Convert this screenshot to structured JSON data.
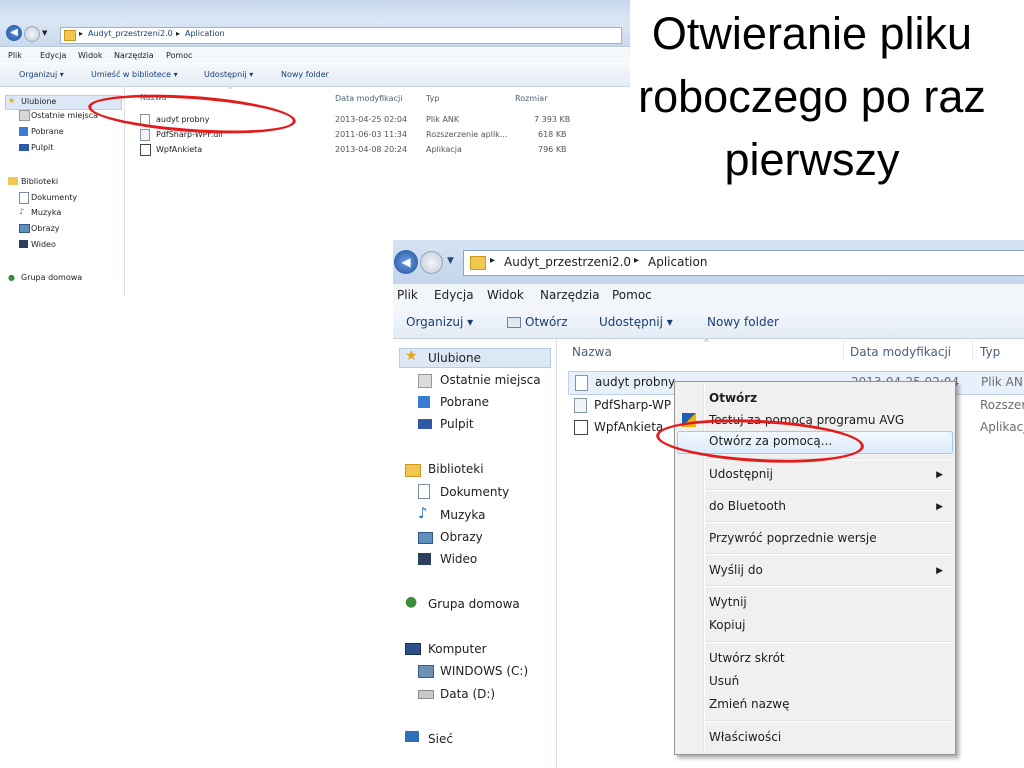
{
  "slide": {
    "title": "Otwieranie pliku roboczego po raz pierwszy"
  },
  "small": {
    "breadcrumb": [
      "Audyt_przestrzeni2.0",
      "Aplication"
    ],
    "menu": [
      "Plik",
      "Edycja",
      "Widok",
      "Narzędzia",
      "Pomoc"
    ],
    "toolbar": [
      "Organizuj ▾",
      "Umieść w bibliotece ▾",
      "Udostępnij ▾",
      "Nowy folder"
    ],
    "nav": {
      "favorites": "Ulubione",
      "favorites_items": [
        "Ostatnie miejsca",
        "Pobrane",
        "Pulpit"
      ],
      "libraries": "Biblioteki",
      "libraries_items": [
        "Dokumenty",
        "Muzyka",
        "Obrazy",
        "Wideo"
      ],
      "homegroup": "Grupa domowa"
    },
    "columns": {
      "name": "Nazwa",
      "date": "Data modyfikacji",
      "type": "Typ",
      "size": "Rozmiar"
    },
    "files": [
      {
        "name": "audyt probny",
        "date": "2013-04-25 02:04",
        "type": "Plik ANK",
        "size": "7 393 KB"
      },
      {
        "name": "PdfSharp-WPF.dll",
        "date": "2011-06-03 11:34",
        "type": "Rozszerzenie aplik...",
        "size": "618 KB"
      },
      {
        "name": "WpfAnkieta",
        "date": "2013-04-08 20:24",
        "type": "Aplikacja",
        "size": "796 KB"
      }
    ]
  },
  "large": {
    "breadcrumb": [
      "Audyt_przestrzeni2.0",
      "Aplication"
    ],
    "menu": [
      "Plik",
      "Edycja",
      "Widok",
      "Narzędzia",
      "Pomoc"
    ],
    "toolbar": {
      "organize": "Organizuj ▾",
      "open": "Otwórz",
      "share": "Udostępnij ▾",
      "new_folder": "Nowy folder"
    },
    "nav": {
      "favorites": "Ulubione",
      "favorites_items": [
        "Ostatnie miejsca",
        "Pobrane",
        "Pulpit"
      ],
      "libraries": "Biblioteki",
      "libraries_items": [
        "Dokumenty",
        "Muzyka",
        "Obrazy",
        "Wideo"
      ],
      "homegroup": "Grupa domowa",
      "computer": "Komputer",
      "computer_items": [
        "WINDOWS (C:)",
        "Data (D:)"
      ],
      "network": "Sieć"
    },
    "columns": {
      "name": "Nazwa",
      "date": "Data modyfikacji",
      "type": "Typ"
    },
    "files": [
      {
        "name": "audyt probny",
        "date": "2013-04-25 02:04",
        "type": "Plik ANK"
      },
      {
        "name": "PdfSharp-WP",
        "type": "Rozszerz"
      },
      {
        "name": "WpfAnkieta",
        "type": "Aplikacj"
      }
    ]
  },
  "context_menu": {
    "open": "Otwórz",
    "scan_avg": "Testuj za pomocą programu AVG",
    "open_with": "Otwórz za pomocą...",
    "share": "Udostępnij",
    "bluetooth": "do Bluetooth",
    "restore": "Przywróć poprzednie wersje",
    "send_to": "Wyślij do",
    "cut": "Wytnij",
    "copy": "Kopiuj",
    "shortcut": "Utwórz skrót",
    "delete": "Usuń",
    "rename": "Zmień nazwę",
    "properties": "Właściwości",
    "submenu_arrow": "▶"
  },
  "colors": {
    "annotation_red": "#e41b1b",
    "window_chrome": "#c9d9ee"
  }
}
